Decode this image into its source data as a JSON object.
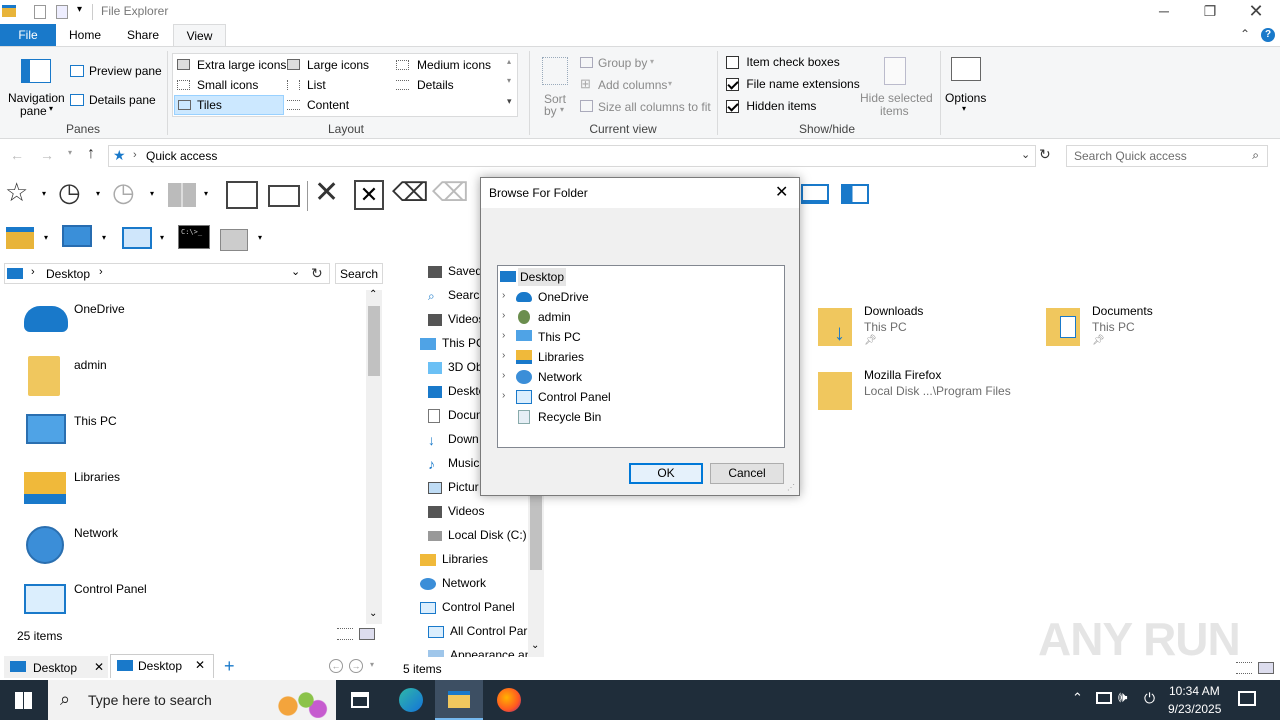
{
  "window": {
    "title": "File Explorer"
  },
  "tabs": [
    "File",
    "Home",
    "Share",
    "View"
  ],
  "ribbon": {
    "panes": {
      "navigation": "Navigation",
      "navigation2": "pane",
      "preview": "Preview pane",
      "details": "Details pane",
      "group": "Panes"
    },
    "layout": {
      "items": [
        "Extra large icons",
        "Large icons",
        "Medium icons",
        "Small icons",
        "List",
        "Details",
        "Tiles",
        "Content"
      ],
      "group": "Layout"
    },
    "current_view": {
      "sort": "Sort",
      "sort2": "by",
      "group_by": "Group by",
      "add_columns": "Add columns",
      "size_columns": "Size all columns to fit",
      "group": "Current view"
    },
    "show_hide": {
      "item_check_boxes": "Item check boxes",
      "file_name_extensions": "File name extensions",
      "hidden_items": "Hidden items",
      "hide_selected": "Hide selected",
      "hide_selected2": "items",
      "group": "Show/hide"
    },
    "options": "Options"
  },
  "address": {
    "path": "Quick access",
    "search_placeholder": "Search Quick access"
  },
  "left_pane": {
    "path": "Desktop",
    "search": "Search I",
    "items": [
      "OneDrive",
      "admin",
      "This PC",
      "Libraries",
      "Network",
      "Control Panel"
    ],
    "status": "25 items"
  },
  "nav_tree": [
    "Saved",
    "Search",
    "Videos",
    "This PC",
    "3D Ob",
    "Deskto",
    "Docum",
    "Down",
    "Music",
    "Pictur",
    "Videos",
    "Local Disk (C:)",
    "Libraries",
    "Network",
    "Control Panel",
    "All Control Par",
    "Appearance an"
  ],
  "files": [
    {
      "name": "Downloads",
      "sub": "This PC"
    },
    {
      "name": "Documents",
      "sub": "This PC"
    },
    {
      "name": "Mozilla Firefox",
      "sub": "Local Disk ...\\Program Files"
    }
  ],
  "right_status": "5 items",
  "bottom_tabs": [
    "Desktop",
    "Desktop"
  ],
  "dialog": {
    "title": "Browse For Folder",
    "tree": [
      "Desktop",
      "OneDrive",
      "admin",
      "This PC",
      "Libraries",
      "Network",
      "Control Panel",
      "Recycle Bin"
    ],
    "ok": "OK",
    "cancel": "Cancel"
  },
  "taskbar": {
    "search_placeholder": "Type here to search",
    "time": "10:34 AM",
    "date": "9/23/2025"
  },
  "watermark": "ANY RUN"
}
